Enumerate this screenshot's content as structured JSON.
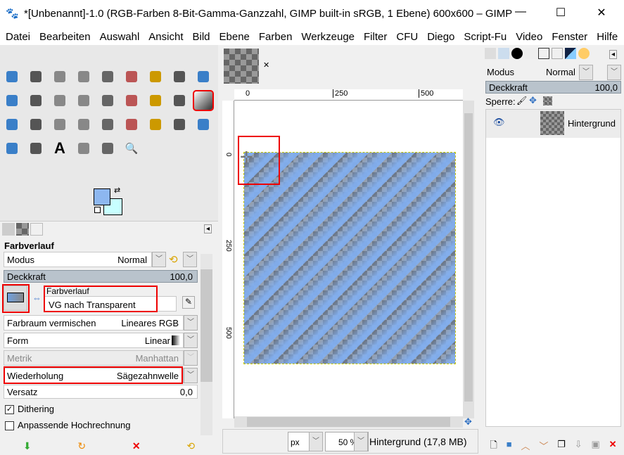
{
  "window": {
    "title": "*[Unbenannt]-1.0 (RGB-Farben 8-Bit-Gamma-Ganzzahl, GIMP built-in sRGB, 1 Ebene) 600x600 – GIMP",
    "minimize": "—",
    "maximize": "☐",
    "close": "✕"
  },
  "menu": [
    "Datei",
    "Bearbeiten",
    "Auswahl",
    "Ansicht",
    "Bild",
    "Ebene",
    "Farben",
    "Werkzeuge",
    "Filter",
    "CFU",
    "Diego",
    "Script-Fu",
    "Video",
    "Fenster",
    "Hilfe"
  ],
  "tools": [
    "move",
    "align",
    "rect-select",
    "ellipse-select",
    "free-select",
    "scissors-select",
    "fuzzy-select",
    "crop",
    "unified-transform",
    "warp",
    "handle-transform",
    "cage",
    "perspective",
    "flip",
    "3d-transform",
    "transform-grid",
    "paths",
    "gradient",
    "paintbrush",
    "pencil",
    "airbrush",
    "ink",
    "mypaint",
    "clone",
    "heal",
    "smudge",
    "dodge",
    "blur",
    "bucket",
    "text",
    "color-picker",
    "measure",
    "zoom"
  ],
  "tool_options": {
    "title": "Farbverlauf",
    "mode_label": "Modus",
    "mode_value": "Normal",
    "opacity_label": "Deckkraft",
    "opacity_value": "100,0",
    "gradient_label": "Farbverlauf",
    "gradient_value": "VG nach Transparent",
    "blend_label": "Farbraum vermischen",
    "blend_value": "Lineares RGB",
    "shape_label": "Form",
    "shape_value": "Linear",
    "metric_label": "Metrik",
    "metric_value": "Manhattan",
    "repeat_label": "Wiederholung",
    "repeat_value": "Sägezahnwelle",
    "offset_label": "Versatz",
    "offset_value": "0,0",
    "dithering_label": "Dithering",
    "dithering_checked": true,
    "adaptive_label": "Anpassende Hochrechnung",
    "adaptive_checked": false
  },
  "colors": {
    "fg": "#8db7f0",
    "bg": "#c8ffff",
    "accent": "#e00000"
  },
  "ruler": {
    "h": [
      "0",
      "250",
      "500"
    ],
    "v": [
      "0",
      "250",
      "500"
    ]
  },
  "status": {
    "unit": "px",
    "zoom": "50 %",
    "info": "Hintergrund (17,8 MB)"
  },
  "layers": {
    "mode_label": "Modus",
    "mode_value": "Normal",
    "opacity_label": "Deckkraft",
    "opacity_value": "100,0",
    "lock_label": "Sperre:",
    "items": [
      {
        "name": "Hintergrund",
        "visible": true
      }
    ]
  }
}
